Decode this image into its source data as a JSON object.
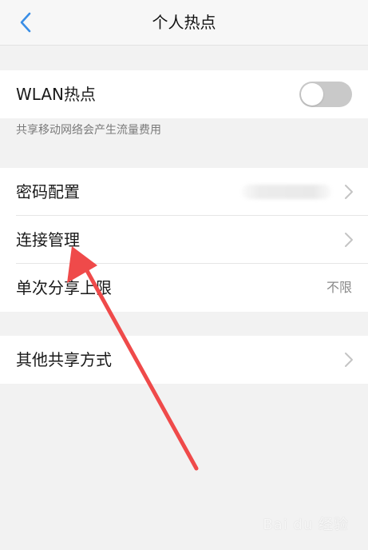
{
  "header": {
    "title": "个人热点",
    "back_icon": "chevron-left-icon"
  },
  "wlan": {
    "label": "WLAN热点",
    "enabled": false,
    "hint": "共享移动网络会产生流量费用"
  },
  "settings": {
    "password_label": "密码配置",
    "connection_label": "连接管理",
    "limit_label": "单次分享上限",
    "limit_value": "不限"
  },
  "other": {
    "label": "其他共享方式"
  },
  "colors": {
    "accent": "#3a8ee6",
    "annotation_arrow": "#ef4a4a"
  },
  "watermark": "Bai du 经验"
}
